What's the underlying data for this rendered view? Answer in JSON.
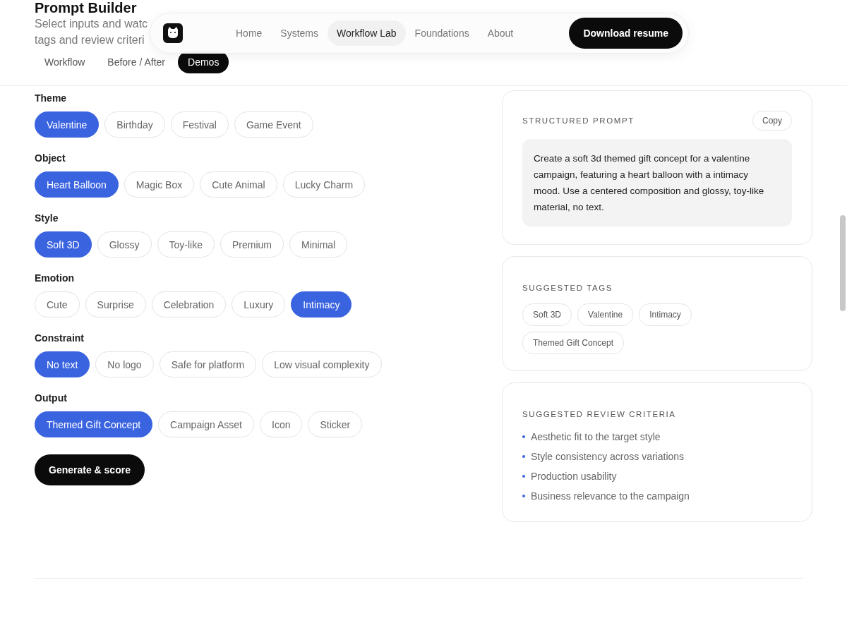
{
  "page": {
    "title": "Prompt Builder",
    "subtitle_lines": [
      "Select inputs and watc",
      "tags and review criteri"
    ]
  },
  "nav": {
    "links": [
      {
        "label": "Home",
        "selected": false
      },
      {
        "label": "Systems",
        "selected": false
      },
      {
        "label": "Workflow Lab",
        "selected": true
      },
      {
        "label": "Foundations",
        "selected": false
      },
      {
        "label": "About",
        "selected": false
      }
    ],
    "cta": "Download resume"
  },
  "tabs": [
    {
      "label": "Workflow",
      "selected": false
    },
    {
      "label": "Before / After",
      "selected": false
    },
    {
      "label": "Demos",
      "selected": true
    }
  ],
  "groups": [
    {
      "label": "Theme",
      "options": [
        {
          "label": "Valentine",
          "selected": true
        },
        {
          "label": "Birthday",
          "selected": false
        },
        {
          "label": "Festival",
          "selected": false
        },
        {
          "label": "Game Event",
          "selected": false
        }
      ]
    },
    {
      "label": "Object",
      "options": [
        {
          "label": "Heart Balloon",
          "selected": true
        },
        {
          "label": "Magic Box",
          "selected": false
        },
        {
          "label": "Cute Animal",
          "selected": false
        },
        {
          "label": "Lucky Charm",
          "selected": false
        }
      ]
    },
    {
      "label": "Style",
      "options": [
        {
          "label": "Soft 3D",
          "selected": true
        },
        {
          "label": "Glossy",
          "selected": false
        },
        {
          "label": "Toy-like",
          "selected": false
        },
        {
          "label": "Premium",
          "selected": false
        },
        {
          "label": "Minimal",
          "selected": false
        }
      ]
    },
    {
      "label": "Emotion",
      "options": [
        {
          "label": "Cute",
          "selected": false
        },
        {
          "label": "Surprise",
          "selected": false
        },
        {
          "label": "Celebration",
          "selected": false
        },
        {
          "label": "Luxury",
          "selected": false
        },
        {
          "label": "Intimacy",
          "selected": true
        }
      ]
    },
    {
      "label": "Constraint",
      "options": [
        {
          "label": "No text",
          "selected": true
        },
        {
          "label": "No logo",
          "selected": false
        },
        {
          "label": "Safe for platform",
          "selected": false
        },
        {
          "label": "Low visual complexity",
          "selected": false
        }
      ]
    },
    {
      "label": "Output",
      "options": [
        {
          "label": "Themed Gift Concept",
          "selected": true
        },
        {
          "label": "Campaign Asset",
          "selected": false
        },
        {
          "label": "Icon",
          "selected": false
        },
        {
          "label": "Sticker",
          "selected": false
        }
      ]
    }
  ],
  "generate_button": "Generate & score",
  "prompt_card": {
    "heading": "STRUCTURED PROMPT",
    "copy_button": "Copy",
    "text": "Create a soft 3d themed gift concept for a valentine campaign, featuring a heart balloon with a intimacy mood. Use a centered composition and glossy, toy-like material, no text."
  },
  "tags_card": {
    "heading": "SUGGESTED TAGS",
    "tags": [
      "Soft 3D",
      "Valentine",
      "Intimacy",
      "Themed Gift Concept"
    ]
  },
  "criteria_card": {
    "heading": "SUGGESTED REVIEW CRITERIA",
    "items": [
      "Aesthetic fit to the target style",
      "Style consistency across variations",
      "Production usability",
      "Business relevance to the campaign"
    ]
  }
}
